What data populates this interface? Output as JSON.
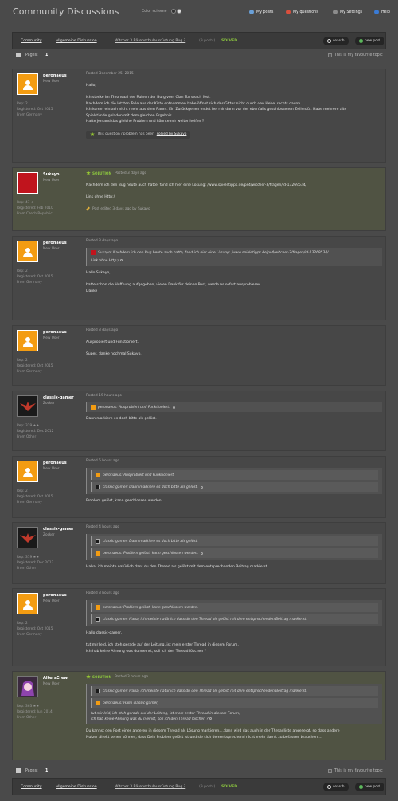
{
  "site_title": "Community Discussions",
  "color_scheme_label": "Color scheme",
  "nav": {
    "my_posts": "My posts",
    "my_questions": "My questions",
    "my_settings": "My Settings",
    "help": "Help"
  },
  "toolbar": {
    "community": "Community",
    "general": "Allgemeine Diskussion",
    "thread": "Witcher 3 Bärenschulausrüstung Bug ?",
    "pages": "(9 posts)",
    "solved": "SOLVED",
    "search": "search",
    "new_post": "new post"
  },
  "pagerow": {
    "label": "Pages:",
    "num": "1",
    "fav": "This is my favourite topic"
  },
  "posts": [
    {
      "user": "peronaeus",
      "rank": "New User",
      "stats": [
        "Rep: 2",
        "Registered: Oct 2015",
        "From Germany"
      ],
      "date": "Posted December 25, 2015",
      "lines": [
        "Hallo,",
        "",
        "ich stecke im Thronsaal der Ruinen der Burg vom Clan Tuirseach fest.",
        "Nachdem ich die letzten Teile aus der Kiste entnommen habe öffnet sich das Gitter nicht durch den Hebel rechts davon.",
        "Ich komm einfach nicht mehr aus dem Raum. Ein Zurückgehen endet bei mir dann vor der ebenfalls geschlossenen Zellentür. Habe mehrere alte",
        "Spielstände geladen mit dem gleichen Ergebnis.",
        "Hatte jemand das gleiche Problem und könnte mir weiter helfen ?"
      ],
      "solved_pre": "This question / problem has been",
      "solved_link": "solved by Sukayo"
    },
    {
      "user": "Sukayo",
      "rank": "New User",
      "stats": [
        "Rep: 47 ★",
        "Registered: Feb 2010",
        "From Czech Republic"
      ],
      "badge": "SOLUTION",
      "date": "Posted 3 days ago",
      "lines": [
        "Nachdem ich den Bug heute auch hatte, fand ich hier eine Lösung: /www.spieletipps.de/ps4/witcher-3/fragen/id-13269534/",
        "",
        "Link ohne Http:/"
      ],
      "edited": "Post edited 3 days ago by Sukayo"
    },
    {
      "user": "peronaeus",
      "rank": "New User",
      "stats": [
        "Rep: 2",
        "Registered: Oct 2015",
        "From Germany"
      ],
      "date": "Posted 3 days ago",
      "quote": "Sukayo: Nachdem ich den Bug heute auch hatte, fand ich hier eine Lösung: /www.spieletipps.de/ps4/witcher-3/fragen/id-13269534/",
      "quote_extra": "Link ohne Http:/",
      "lines": [
        "Hallo Sukayo,",
        "",
        "hatte schon die Hoffnung aufgegeben, vielen Dank für deinen Post, werde es sofort ausprobieren.",
        "Danke"
      ]
    },
    {
      "user": "peronaeus",
      "rank": "New User",
      "stats": [
        "Rep: 2",
        "Registered: Oct 2015",
        "From Germany"
      ],
      "date": "Posted 3 days ago",
      "lines": [
        "Ausprobiert und Funktioniert.",
        "",
        "Super, danke nochmal Sukayo."
      ]
    },
    {
      "user": "classic-gamer",
      "rank": "Zocker",
      "stats": [
        "Rep: 319 ★★",
        "Registered: Dec 2012",
        "From Other"
      ],
      "date": "Posted 19 hours ago",
      "quote": "peronaeus: Ausprobiert und Funktioniert.",
      "lines": [
        "Dann markiere es doch bitte als gelöst."
      ]
    },
    {
      "user": "peronaeus",
      "rank": "New User",
      "stats": [
        "Rep: 2",
        "Registered: Oct 2015",
        "From Germany"
      ],
      "date": "Posted 5 hours ago",
      "quotes": [
        "peronaeus: Ausprobiert und Funktioniert.",
        "classic-gamer: Dann markiere es doch bitte als gelöst."
      ],
      "lines": [
        "Problem gelöst, kann geschlossen werden."
      ]
    },
    {
      "user": "classic-gamer",
      "rank": "Zocker",
      "stats": [
        "Rep: 319 ★★",
        "Registered: Dec 2012",
        "From Other"
      ],
      "date": "Posted 4 hours ago",
      "quotes": [
        "classic-gamer: Dann markiere es doch bitte als gelöst.",
        "peronaeus: Problem gelöst, kann geschlossen werden."
      ],
      "lines": [
        "Haha, ich meinte natürlich dass du den Thread als gelöst mit dem entsprechenden Beitrag markierst."
      ]
    },
    {
      "user": "peronaeus",
      "rank": "New User",
      "stats": [
        "Rep: 2",
        "Registered: Oct 2015",
        "From Germany"
      ],
      "date": "Posted 3 hours ago",
      "quotes": [
        "peronaeus: Problem gelöst, kann geschlossen werden.",
        "classic-gamer: Haha, ich meinte natürlich dass du den Thread als gelöst mit dem entsprechenden Beitrag markierst."
      ],
      "lines": [
        "Hallo classic-gamer,",
        "",
        "tut mir leid, ich steh gerade auf der Leitung, ist mein erster Thread in diesem Forum,",
        "ich hab keine Ahnung was du meinst, soll ich den Thread löschen ?"
      ]
    },
    {
      "user": "AltersCrew",
      "rank": "New User",
      "stats": [
        "Rep: 363 ★★",
        "Registered: Jun 2014",
        "From Other"
      ],
      "badge": "SOLUTION",
      "date": "Posted 3 hours ago",
      "quotes": [
        "classic-gamer: Haha, ich meinte natürlich dass du den Thread als gelöst mit dem entsprechenden Beitrag markierst.",
        "peronaeus: Hallo classic-gamer,"
      ],
      "quote_extra_lines": [
        "tut mir leid, ich steh gerade auf der Leitung, ist mein erster Thread in diesem Forum,",
        "ich hab keine Ahnung was du meinst, soll ich den Thread löschen ?"
      ],
      "lines": [
        "Du kannst den Post eines anderen in diesem Thread als Lösung markieren....dann wird das auch in der Threadliste angezeigt, so dass andere",
        "Nutzer direkt sehen können, dass Dein Problem gelöst ist und sie sich dementsprechend nicht mehr damit zu befassen brauchen...."
      ]
    }
  ]
}
